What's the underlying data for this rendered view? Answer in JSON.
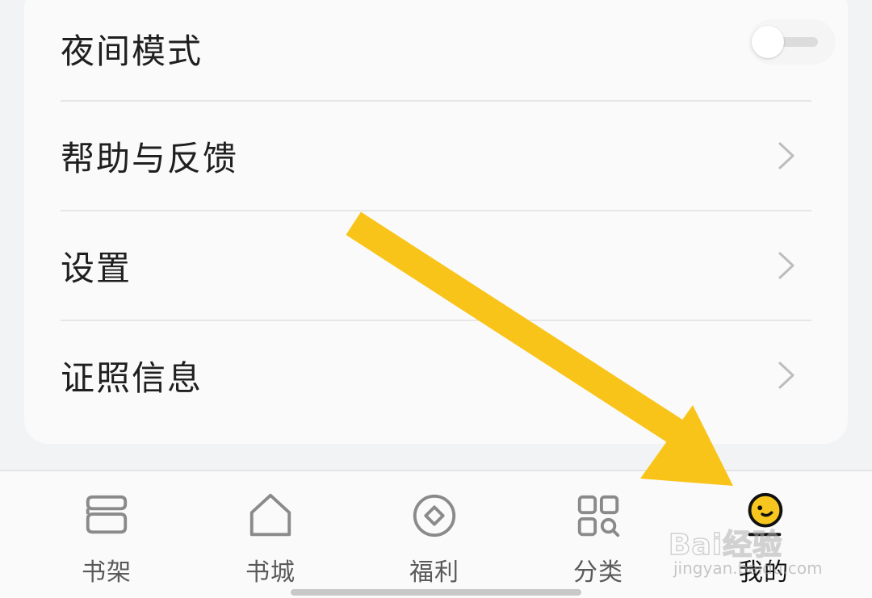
{
  "settings": {
    "night_mode": {
      "label": "夜间模式",
      "enabled": false
    },
    "help_feedback": {
      "label": "帮助与反馈"
    },
    "settings": {
      "label": "设置"
    },
    "license_info": {
      "label": "证照信息"
    }
  },
  "tabbar": {
    "tabs": [
      {
        "label": "书架",
        "icon": "bookshelf-icon",
        "active": false
      },
      {
        "label": "书城",
        "icon": "home-icon",
        "active": false
      },
      {
        "label": "福利",
        "icon": "welfare-icon",
        "active": false
      },
      {
        "label": "分类",
        "icon": "category-icon",
        "active": false
      },
      {
        "label": "我的",
        "icon": "profile-icon",
        "active": true
      }
    ]
  },
  "watermark": {
    "logo": "Bai经验",
    "sub": "jingyan.baidu.com"
  },
  "colors": {
    "accent": "#f8c71f",
    "arrow": "#f9c41a",
    "text": "#1f1f1f",
    "inactive_icon": "#8a8a8a"
  }
}
